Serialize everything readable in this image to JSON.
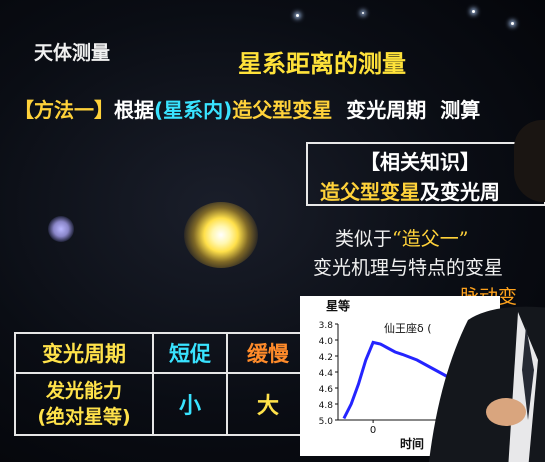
{
  "slide": {
    "topic": "天体测量",
    "title": "星系距离的测量",
    "method": {
      "bracket_label": "【方法一】",
      "text_before": "根据",
      "highlight": "(星系内)",
      "star_type": "造父型变星",
      "period": "变光周期",
      "measure": "测算"
    },
    "knowledge_box": {
      "header": "【相关知识】",
      "term": "造父型变星",
      "rest": "及变光周"
    },
    "similar": {
      "line1_prefix": "类似于",
      "line1_quote": "“造父一”",
      "line2": "变光机理与特点的变星",
      "line3": "脉动变"
    },
    "table": {
      "headers": [
        "变光周期",
        "短促",
        "缓慢"
      ],
      "row_label_1": "发光能力",
      "row_label_2": "(绝对星等)",
      "small": "小",
      "large": "大"
    },
    "chart": {
      "ylabel": "星等",
      "xlabel": "时间",
      "series_label": "仙王座δ (",
      "y_ticks": [
        "3.8",
        "4.0",
        "4.2",
        "4.4",
        "4.6",
        "4.8",
        "5.0"
      ],
      "x_tick": "0"
    }
  },
  "colors": {
    "yellow": "#ffe23a",
    "cyan": "#39e3ff",
    "orange": "#ff8b2a",
    "curve": "#2424ff"
  },
  "chart_data": {
    "type": "line",
    "title": "",
    "xlabel": "时间",
    "ylabel": "星等",
    "ylim": [
      3.8,
      5.0
    ],
    "y_inverted": true,
    "yticks": [
      3.8,
      4.0,
      4.2,
      4.4,
      4.6,
      4.8,
      5.0
    ],
    "series": [
      {
        "name": "仙王座δ (",
        "x": [
          -1.0,
          -0.75,
          -0.5,
          -0.25,
          0.0,
          0.25,
          0.5,
          0.75,
          1.0,
          1.5,
          2.0,
          2.5,
          3.0,
          3.5
        ],
        "y": [
          4.98,
          4.8,
          4.55,
          4.25,
          4.03,
          4.05,
          4.1,
          4.15,
          4.18,
          4.25,
          4.35,
          4.45,
          4.55,
          4.63
        ]
      }
    ]
  }
}
